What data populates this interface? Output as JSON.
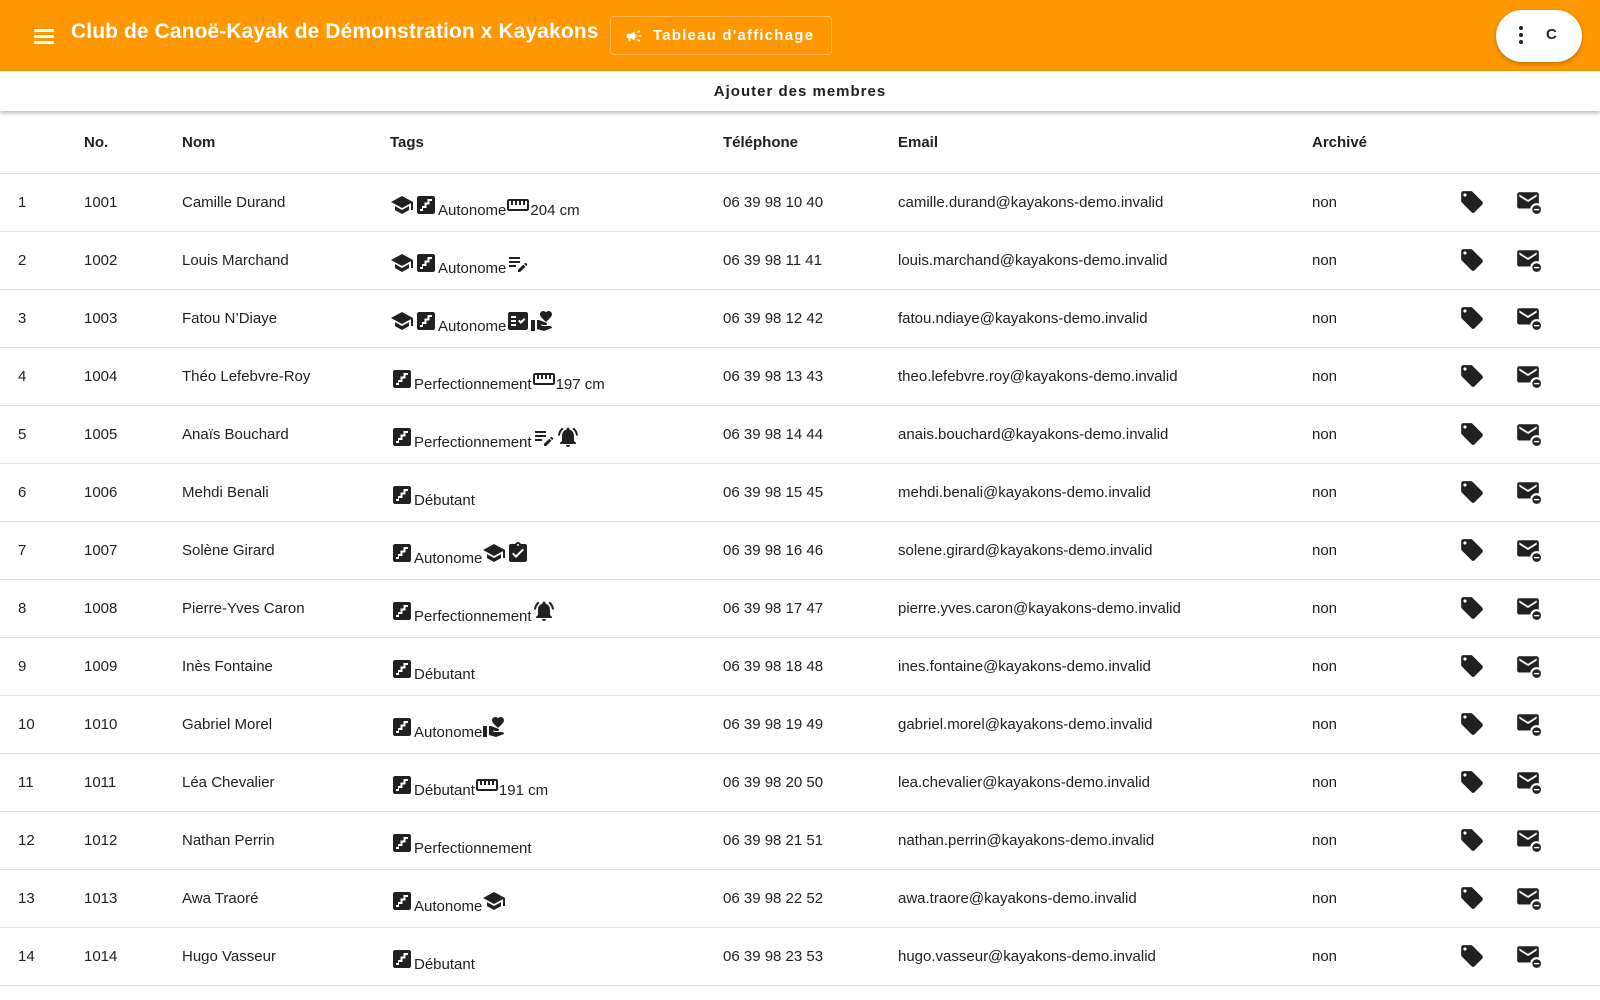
{
  "header": {
    "title": "Club de Canoë-Kayak de Démonstration x Kayakons",
    "board_button": "Tableau d'affichage",
    "user_initial": "C"
  },
  "add_members_label": "Ajouter des membres",
  "table": {
    "columns": [
      "",
      "No.",
      "Nom",
      "Tags",
      "Téléphone",
      "Email",
      "Archivé",
      "",
      ""
    ],
    "rows": [
      {
        "idx": "1",
        "no": "1001",
        "nom": "Camille Durand",
        "tags": [
          {
            "icon": "school-icon"
          },
          {
            "icon": "stairs-icon"
          },
          {
            "text": "Autonome"
          },
          {
            "icon": "ruler-icon"
          },
          {
            "text": "204 cm"
          }
        ],
        "tel": "06 39 98 10 40",
        "email": "camille.durand@kayakons-demo.invalid",
        "arch": "non"
      },
      {
        "idx": "2",
        "no": "1002",
        "nom": "Louis Marchand",
        "tags": [
          {
            "icon": "school-icon"
          },
          {
            "icon": "stairs-icon"
          },
          {
            "text": "Autonome"
          },
          {
            "icon": "edit-note-icon"
          }
        ],
        "tel": "06 39 98 11 41",
        "email": "louis.marchand@kayakons-demo.invalid",
        "arch": "non"
      },
      {
        "idx": "3",
        "no": "1003",
        "nom": "Fatou N’Diaye",
        "tags": [
          {
            "icon": "school-icon"
          },
          {
            "icon": "stairs-icon"
          },
          {
            "text": "Autonome"
          },
          {
            "icon": "fact-check-icon"
          },
          {
            "icon": "volunteer-icon"
          }
        ],
        "tel": "06 39 98 12 42",
        "email": "fatou.ndiaye@kayakons-demo.invalid",
        "arch": "non"
      },
      {
        "idx": "4",
        "no": "1004",
        "nom": "Théo Lefebvre-Roy",
        "tags": [
          {
            "icon": "stairs-icon"
          },
          {
            "text": "Perfectionnement"
          },
          {
            "icon": "ruler-icon"
          },
          {
            "text": "197 cm"
          }
        ],
        "tel": "06 39 98 13 43",
        "email": "theo.lefebvre.roy@kayakons-demo.invalid",
        "arch": "non"
      },
      {
        "idx": "5",
        "no": "1005",
        "nom": "Anaïs Bouchard",
        "tags": [
          {
            "icon": "stairs-icon"
          },
          {
            "text": "Perfectionnement"
          },
          {
            "icon": "edit-note-icon"
          },
          {
            "icon": "alarm-icon"
          }
        ],
        "tel": "06 39 98 14 44",
        "email": "anais.bouchard@kayakons-demo.invalid",
        "arch": "non"
      },
      {
        "idx": "6",
        "no": "1006",
        "nom": "Mehdi Benali",
        "tags": [
          {
            "icon": "stairs-icon"
          },
          {
            "text": "Débutant"
          }
        ],
        "tel": "06 39 98 15 45",
        "email": "mehdi.benali@kayakons-demo.invalid",
        "arch": "non"
      },
      {
        "idx": "7",
        "no": "1007",
        "nom": "Solène Girard",
        "tags": [
          {
            "icon": "stairs-icon"
          },
          {
            "text": "Autonome"
          },
          {
            "icon": "school-icon"
          },
          {
            "icon": "clipboard-check-icon"
          }
        ],
        "tel": "06 39 98 16 46",
        "email": "solene.girard@kayakons-demo.invalid",
        "arch": "non"
      },
      {
        "idx": "8",
        "no": "1008",
        "nom": "Pierre-Yves Caron",
        "tags": [
          {
            "icon": "stairs-icon"
          },
          {
            "text": "Perfectionnement"
          },
          {
            "icon": "alarm-icon"
          }
        ],
        "tel": "06 39 98 17 47",
        "email": "pierre.yves.caron@kayakons-demo.invalid",
        "arch": "non"
      },
      {
        "idx": "9",
        "no": "1009",
        "nom": "Inès Fontaine",
        "tags": [
          {
            "icon": "stairs-icon"
          },
          {
            "text": "Débutant"
          }
        ],
        "tel": "06 39 98 18 48",
        "email": "ines.fontaine@kayakons-demo.invalid",
        "arch": "non"
      },
      {
        "idx": "10",
        "no": "1010",
        "nom": "Gabriel Morel",
        "tags": [
          {
            "icon": "stairs-icon"
          },
          {
            "text": "Autonome"
          },
          {
            "icon": "volunteer-icon"
          }
        ],
        "tel": "06 39 98 19 49",
        "email": "gabriel.morel@kayakons-demo.invalid",
        "arch": "non"
      },
      {
        "idx": "11",
        "no": "1011",
        "nom": "Léa Chevalier",
        "tags": [
          {
            "icon": "stairs-icon"
          },
          {
            "text": "Débutant"
          },
          {
            "icon": "ruler-icon"
          },
          {
            "text": "191 cm"
          }
        ],
        "tel": "06 39 98 20 50",
        "email": "lea.chevalier@kayakons-demo.invalid",
        "arch": "non"
      },
      {
        "idx": "12",
        "no": "1012",
        "nom": "Nathan Perrin",
        "tags": [
          {
            "icon": "stairs-icon"
          },
          {
            "text": "Perfectionnement"
          }
        ],
        "tel": "06 39 98 21 51",
        "email": "nathan.perrin@kayakons-demo.invalid",
        "arch": "non"
      },
      {
        "idx": "13",
        "no": "1013",
        "nom": "Awa Traoré",
        "tags": [
          {
            "icon": "stairs-icon"
          },
          {
            "text": "Autonome"
          },
          {
            "icon": "school-icon"
          }
        ],
        "tel": "06 39 98 22 52",
        "email": "awa.traore@kayakons-demo.invalid",
        "arch": "non"
      },
      {
        "idx": "14",
        "no": "1014",
        "nom": "Hugo Vasseur",
        "tags": [
          {
            "icon": "stairs-icon"
          },
          {
            "text": "Débutant"
          }
        ],
        "tel": "06 39 98 23 53",
        "email": "hugo.vasseur@kayakons-demo.invalid",
        "arch": "non"
      }
    ]
  },
  "colors": {
    "primary": "#ff9800",
    "text": "#212121",
    "divider": "#e0e0e0"
  }
}
